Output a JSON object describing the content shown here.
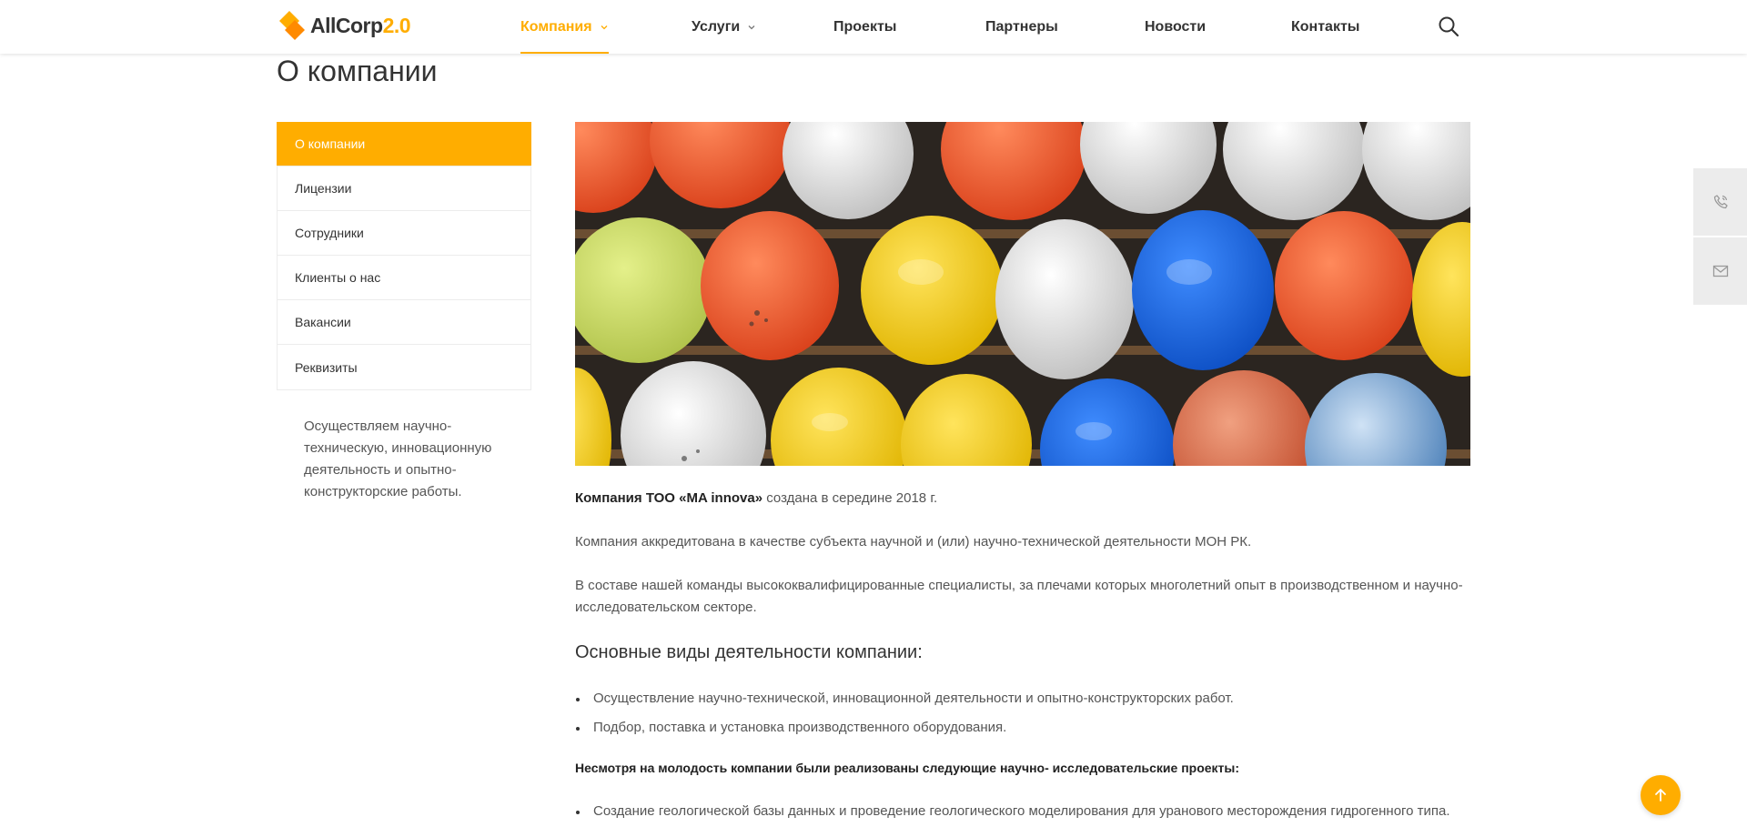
{
  "brand": {
    "name": "AllCorp",
    "version": "2.0",
    "accent": "#ffad00"
  },
  "nav": {
    "items": [
      {
        "label": "Компания",
        "active": true,
        "dropdown": true
      },
      {
        "label": "Услуги",
        "active": false,
        "dropdown": true
      },
      {
        "label": "Проекты",
        "active": false,
        "dropdown": false
      },
      {
        "label": "Партнеры",
        "active": false,
        "dropdown": false
      },
      {
        "label": "Новости",
        "active": false,
        "dropdown": false
      },
      {
        "label": "Контакты",
        "active": false,
        "dropdown": false
      }
    ],
    "search_icon": "search-icon"
  },
  "page": {
    "title": "О компании"
  },
  "sidebar": {
    "items": [
      {
        "label": "О компании",
        "active": true
      },
      {
        "label": "Лицензии",
        "active": false
      },
      {
        "label": "Сотрудники",
        "active": false
      },
      {
        "label": "Клиенты о нас",
        "active": false
      },
      {
        "label": "Вакансии",
        "active": false
      },
      {
        "label": "Реквизиты",
        "active": false
      }
    ],
    "description": "Осуществляем научно-техническую, инновационную деятельность и опытно-конструкторские работы."
  },
  "content": {
    "intro_bold": "Компания ТОО «MA innova»",
    "intro_rest": " создана в середине 2018 г.",
    "p2": "Компания аккредитована в качестве субъекта научной и (или) научно-технической деятельности МОН РК.",
    "p3": "В составе нашей команды высококвалифицированные специалисты, за плечами которых многолетний опыт в производственном и научно-исследовательском секторе.",
    "activities_title": "Основные виды деятельности компании:",
    "activities": [
      "Осуществление научно-технической, инновационной деятельности и опытно-конструкторских работ.",
      "Подбор, поставка и установка производственного оборудования."
    ],
    "projects_title": "Несмотря на молодость компании были реализованы следующие научно- исследовательские проекты:",
    "projects": [
      "Создание геологической базы данных и проведение геологического моделирования для уранового месторождения гидрогенного типа."
    ]
  },
  "floating": {
    "phone_icon": "phone-icon",
    "mail_icon": "mail-icon"
  },
  "scroll_top_icon": "arrow-up-icon"
}
